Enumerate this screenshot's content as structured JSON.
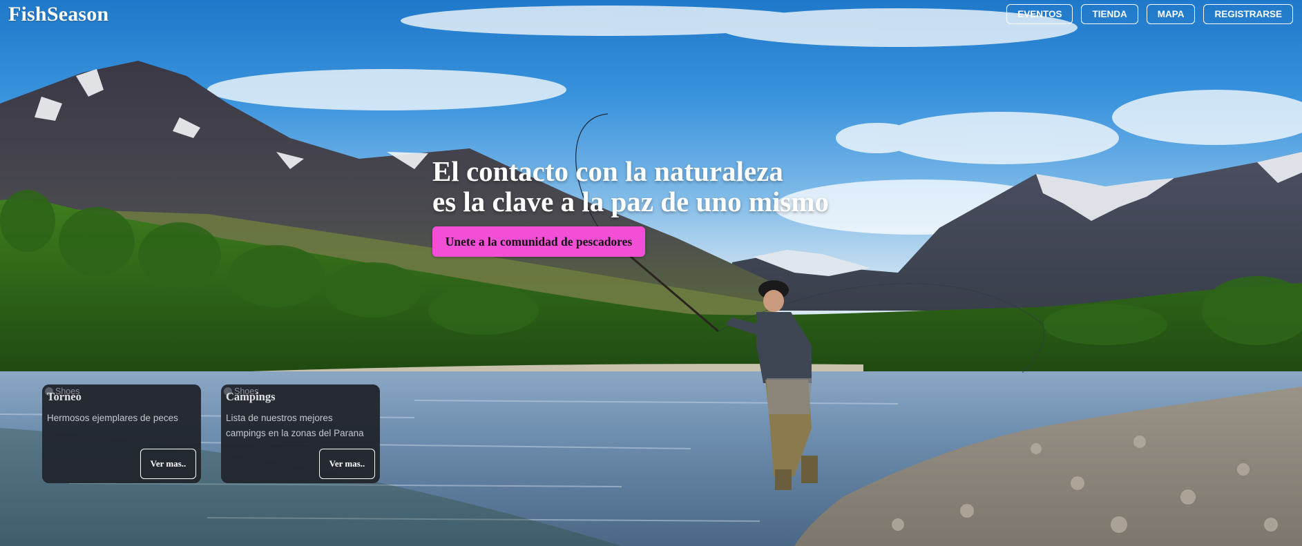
{
  "brand": {
    "name": "FishSeason"
  },
  "nav": {
    "items": [
      {
        "label": "EVENTOS"
      },
      {
        "label": "TIENDA"
      },
      {
        "label": "MAPA"
      },
      {
        "label": "REGISTRARSE"
      }
    ]
  },
  "hero": {
    "headline_line1": "El contacto con la naturaleza",
    "headline_line2": "es la clave a la paz de uno mismo",
    "cta_label": "Unete a la comunidad de pescadores",
    "cta_color": "#f24fd6",
    "background_scene": "fly fisherman standing in a river with snowy mountains and forest"
  },
  "cards": [
    {
      "image_alt": "Shoes",
      "title": "Torneo",
      "description": "Hermosos ejemplares de peces",
      "button_label": "Ver mas.."
    },
    {
      "image_alt": "Shoes",
      "title": "Campings",
      "description": "Lista de nuestros mejores campings en la zonas del Parana",
      "button_label": "Ver mas.."
    }
  ]
}
